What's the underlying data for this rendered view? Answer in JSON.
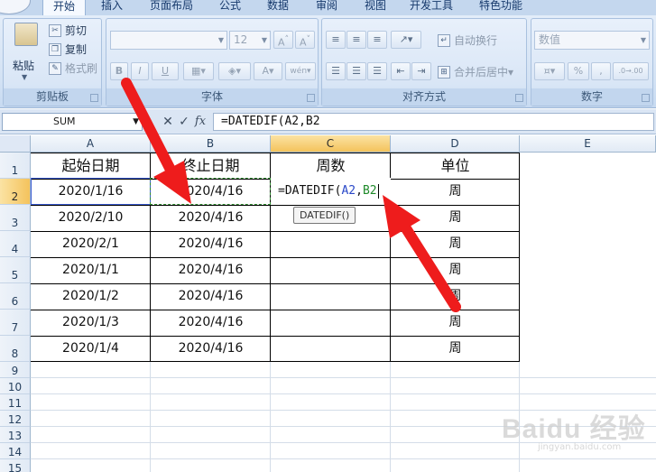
{
  "ribbon": {
    "tabs": [
      "开始",
      "插入",
      "页面布局",
      "公式",
      "数据",
      "审阅",
      "视图",
      "开发工具",
      "特色功能"
    ],
    "clipboard": {
      "paste": "粘贴",
      "cut": "剪切",
      "copy": "复制",
      "format_painter": "格式刷",
      "label": "剪贴板"
    },
    "font": {
      "size": "12",
      "bold": "B",
      "italic": "I",
      "underline": "U",
      "grow": "A",
      "shrink": "A",
      "wen": "wén",
      "label": "字体"
    },
    "alignment": {
      "wrap": "自动换行",
      "merge": "合并后居中",
      "label": "对齐方式"
    },
    "number": {
      "format": "数值",
      "percent": "%",
      "comma": ",",
      "dec_inc": ".0→.00",
      "label": "数字"
    }
  },
  "formula_bar": {
    "name_box": "SUM",
    "cancel": "✕",
    "enter": "✓",
    "fx": "fx",
    "formula": "=DATEDIF(A2,B2"
  },
  "sheet": {
    "columns": [
      "A",
      "B",
      "C",
      "D",
      "E"
    ],
    "rows": [
      "1",
      "2",
      "3",
      "4",
      "5",
      "6",
      "7",
      "8",
      "9",
      "10",
      "11",
      "12",
      "13",
      "14",
      "15"
    ],
    "header": [
      "起始日期",
      "终止日期",
      "周数",
      "单位"
    ],
    "data": [
      [
        "2020/1/16",
        "2020/4/16",
        "",
        "周"
      ],
      [
        "2020/2/10",
        "2020/4/16",
        "",
        "周"
      ],
      [
        "2020/2/1",
        "2020/4/16",
        "",
        "周"
      ],
      [
        "2020/1/1",
        "2020/4/16",
        "",
        "周"
      ],
      [
        "2020/1/2",
        "2020/4/16",
        "",
        "周"
      ],
      [
        "2020/1/3",
        "2020/4/16",
        "",
        "周"
      ],
      [
        "2020/1/4",
        "2020/4/16",
        "",
        "周"
      ]
    ],
    "edit": {
      "prefix": "=DATEDIF(",
      "ref1": "A2",
      "sep": ",",
      "ref2": "B2"
    },
    "tooltip": "DATEDIF()"
  },
  "watermark": {
    "text": "Baidu 经验",
    "sub": "jingyan.baidu.com"
  },
  "colors": {
    "arrow": "#ee1c1c",
    "ref_a": "#2a48c8",
    "ref_b": "#1f8a2a"
  }
}
